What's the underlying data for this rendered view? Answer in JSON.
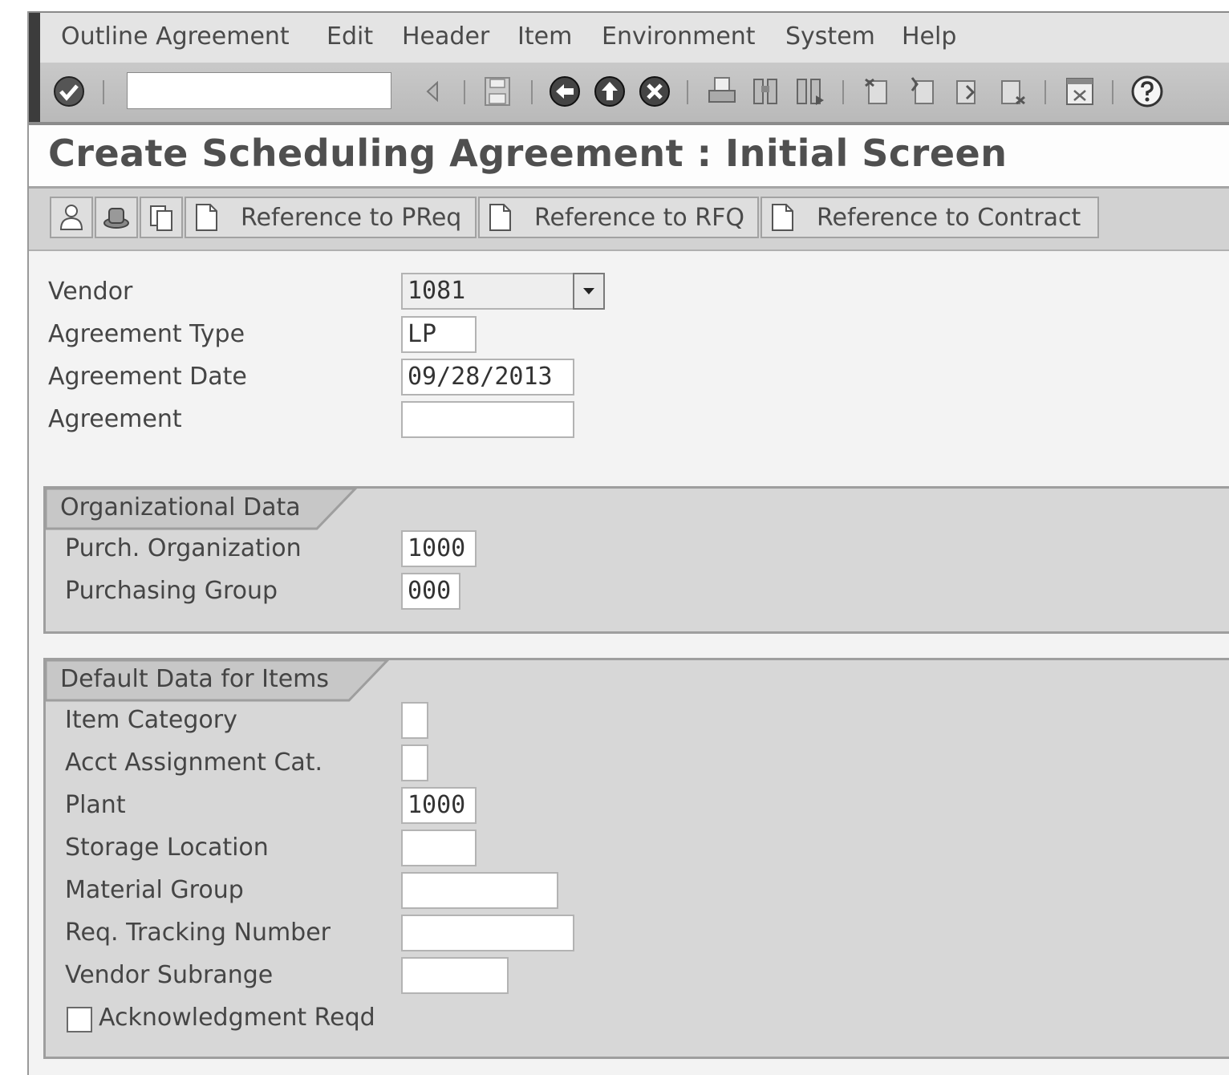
{
  "menu": [
    "Outline Agreement",
    "Edit",
    "Header",
    "Item",
    "Environment",
    "System",
    "Help"
  ],
  "toolbar": {
    "command_value": "",
    "icons": [
      "enter-icon",
      "back-small-icon",
      "save-icon",
      "back-icon",
      "exit-icon",
      "cancel-icon",
      "print-icon",
      "find-icon",
      "find-next-icon",
      "first-page-icon",
      "previous-page-icon",
      "next-page-icon",
      "last-page-icon",
      "layout-icon",
      "help-icon"
    ]
  },
  "title": "Create Scheduling Agreement : Initial Screen",
  "app_toolbar": {
    "icons": [
      "person-icon",
      "hat-icon",
      "copy-icon"
    ],
    "buttons": [
      "Reference to PReq",
      "Reference to RFQ",
      "Reference to Contract"
    ]
  },
  "header": {
    "vendor_label": "Vendor",
    "vendor_value": "1081",
    "agreement_type_label": "Agreement Type",
    "agreement_type_value": "LP",
    "agreement_date_label": "Agreement Date",
    "agreement_date_value": "09/28/2013",
    "agreement_label": "Agreement",
    "agreement_value": ""
  },
  "org": {
    "title": "Organizational Data",
    "purch_org_label": "Purch. Organization",
    "purch_org_value": "1000",
    "purch_group_label": "Purchasing Group",
    "purch_group_value": "000"
  },
  "defaults": {
    "title": "Default Data for Items",
    "item_category_label": "Item Category",
    "item_category_value": "",
    "acct_assignment_label": "Acct Assignment Cat.",
    "acct_assignment_value": "",
    "plant_label": "Plant",
    "plant_value": "1000",
    "storage_location_label": "Storage Location",
    "storage_location_value": "",
    "material_group_label": "Material Group",
    "material_group_value": "",
    "req_tracking_label": "Req. Tracking Number",
    "req_tracking_value": "",
    "vendor_subrange_label": "Vendor Subrange",
    "vendor_subrange_value": "",
    "ack_label": "Acknowledgment Reqd",
    "ack_checked": false
  }
}
